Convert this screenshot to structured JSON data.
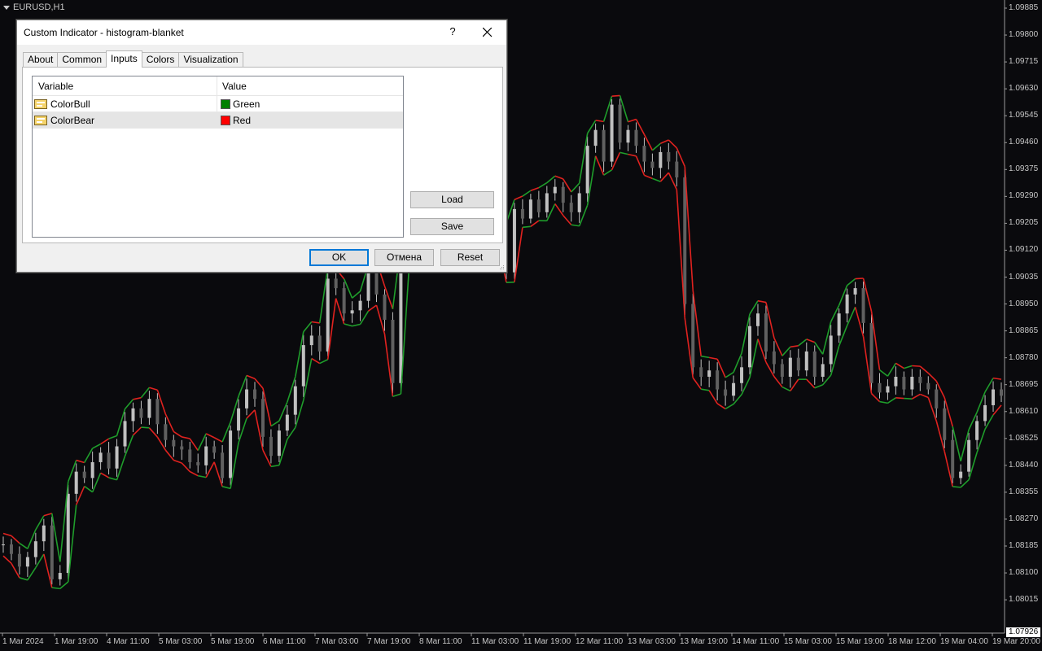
{
  "chart": {
    "symbol": "EURUSD,H1",
    "price_labels": [
      "1.09885",
      "1.09800",
      "1.09715",
      "1.09630",
      "1.09545",
      "1.09460",
      "1.09375",
      "1.09290",
      "1.09205",
      "1.09120",
      "1.09035",
      "1.08950",
      "1.08865",
      "1.08780",
      "1.08695",
      "1.08610",
      "1.08525",
      "1.08440",
      "1.08355",
      "1.08270",
      "1.08185",
      "1.08100",
      "1.08015"
    ],
    "last_price": "1.07926",
    "time_labels": [
      "1 Mar 2024",
      "1 Mar 19:00",
      "4 Mar 11:00",
      "5 Mar 03:00",
      "5 Mar 19:00",
      "6 Mar 11:00",
      "7 Mar 03:00",
      "7 Mar 19:00",
      "8 Mar 11:00",
      "11 Mar 03:00",
      "11 Mar 19:00",
      "12 Mar 11:00",
      "13 Mar 03:00",
      "13 Mar 19:00",
      "14 Mar 11:00",
      "15 Mar 03:00",
      "15 Mar 19:00",
      "18 Mar 12:00",
      "19 Mar 04:00",
      "19 Mar 20:00"
    ],
    "colors": {
      "background": "#0a0a0d",
      "bull_line": "#1f9d2b",
      "bear_line": "#e0221f",
      "candle": "#c0c0c0",
      "axis": "#9a9a9a",
      "text": "#c8c8c8"
    },
    "price_series": [
      1.0819,
      1.0816,
      1.0812,
      1.0815,
      1.082,
      1.0825,
      1.0808,
      1.081,
      1.0835,
      1.0842,
      1.084,
      1.0845,
      1.0848,
      1.0843,
      1.085,
      1.0858,
      1.0862,
      1.0859,
      1.0865,
      1.0857,
      1.0852,
      1.085,
      1.0849,
      1.0845,
      1.0844,
      1.085,
      1.0848,
      1.084,
      1.0855,
      1.0862,
      1.0868,
      1.0865,
      1.0853,
      1.0847,
      1.0855,
      1.086,
      1.0869,
      1.0882,
      1.0885,
      1.088,
      1.0903,
      1.09,
      1.0892,
      1.0893,
      1.0896,
      1.0905,
      1.0898,
      1.089,
      1.087,
      1.091,
      1.0921,
      1.093,
      1.0925,
      1.0915,
      1.0918,
      1.0922,
      1.0927,
      1.0934,
      1.0938,
      1.0935,
      1.093,
      1.0918,
      1.0905,
      1.0925,
      1.0922,
      1.0928,
      1.0924,
      1.093,
      1.0932,
      1.0927,
      1.0924,
      1.093,
      1.0945,
      1.095,
      1.094,
      1.0958,
      1.0946,
      1.095,
      1.0945,
      1.094,
      1.0938,
      1.0943,
      1.094,
      1.0935,
      1.0895,
      1.0875,
      1.0872,
      1.0874,
      1.0868,
      1.0866,
      1.087,
      1.0875,
      1.0888,
      1.0892,
      1.088,
      1.0876,
      1.0872,
      1.0878,
      1.0874,
      1.088,
      1.0872,
      1.0876,
      1.0885,
      1.0892,
      1.0898,
      1.09,
      1.0889,
      1.087,
      1.0867,
      1.0869,
      1.0872,
      1.0868,
      1.0872,
      1.087,
      1.0868,
      1.0862,
      1.0852,
      1.084,
      1.0842,
      1.0852,
      1.0858,
      1.0863,
      1.0868,
      1.0866
    ]
  },
  "dialog": {
    "title": "Custom Indicator - histogram-blanket",
    "help": "?",
    "tabs": [
      {
        "label": "About"
      },
      {
        "label": "Common"
      },
      {
        "label": "Inputs"
      },
      {
        "label": "Colors"
      },
      {
        "label": "Visualization"
      }
    ],
    "grid": {
      "col_variable": "Variable",
      "col_value": "Value",
      "rows": [
        {
          "variable": "ColorBull",
          "value": "Green",
          "swatch": "#008000"
        },
        {
          "variable": "ColorBear",
          "value": "Red",
          "swatch": "#ff0000"
        }
      ]
    },
    "load_label": "Load",
    "save_label": "Save",
    "ok_label": "OK",
    "cancel_label": "Отмена",
    "reset_label": "Reset"
  }
}
